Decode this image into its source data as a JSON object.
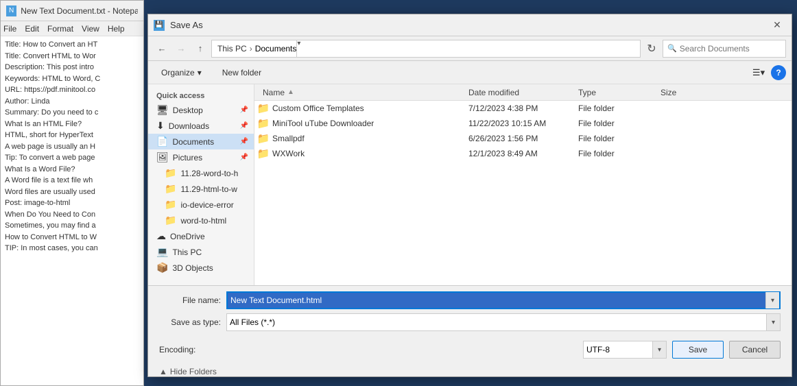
{
  "notepad": {
    "title": "New Text Document.txt - Notepad",
    "menu": [
      "File",
      "Edit",
      "Format",
      "View",
      "Help"
    ],
    "lines": [
      "Title: How to Convert an HT",
      "Title: Convert HTML to Wor",
      "Description: This post intro",
      "Keywords: HTML to Word, C",
      "URL: https://pdf.minitool.co",
      "Author: Linda",
      "Summary: Do you need to c",
      "What Is an HTML File?",
      "HTML, short for HyperText",
      "A web page is usually an H",
      "Tip: To convert a web page",
      "What Is a Word File?",
      "A Word file is a text file wh",
      "Word files are usually used",
      "Post: image-to-html",
      "When Do You Need to Con",
      "Sometimes, you may find a",
      "How to Convert HTML to W",
      "TIP: In most cases, you can"
    ]
  },
  "dialog": {
    "title": "Save As",
    "close_label": "✕",
    "address": {
      "back_tooltip": "Back",
      "forward_tooltip": "Forward",
      "up_tooltip": "Up",
      "path_parts": [
        "This PC",
        "Documents"
      ],
      "refresh_label": "⟳",
      "search_placeholder": "Search Documents"
    },
    "toolbar": {
      "organize_label": "Organize",
      "organize_arrow": "▾",
      "new_folder_label": "New folder",
      "view_icon": "☰",
      "view_arrow": "▾",
      "help_label": "?"
    },
    "columns": {
      "name": "Name",
      "sort_arrow": "▲",
      "date_modified": "Date modified",
      "type": "Type",
      "size": "Size"
    },
    "sidebar": {
      "quick_access_label": "Quick access",
      "items": [
        {
          "id": "desktop",
          "label": "Desktop",
          "icon": "🖥",
          "pinned": true
        },
        {
          "id": "downloads",
          "label": "Downloads",
          "icon": "⬇",
          "pinned": true
        },
        {
          "id": "documents",
          "label": "Documents",
          "icon": "📄",
          "pinned": true,
          "active": true
        },
        {
          "id": "pictures",
          "label": "Pictures",
          "icon": "🖼",
          "pinned": true
        },
        {
          "id": "folder1",
          "label": "11.28-word-to-h",
          "icon": "📁"
        },
        {
          "id": "folder2",
          "label": "11.29-html-to-w",
          "icon": "📁"
        },
        {
          "id": "folder3",
          "label": "io-device-error",
          "icon": "📁"
        },
        {
          "id": "folder4",
          "label": "word-to-html",
          "icon": "📁"
        },
        {
          "id": "onedrive",
          "label": "OneDrive",
          "icon": "☁"
        },
        {
          "id": "thispc",
          "label": "This PC",
          "icon": "💻"
        },
        {
          "id": "3dobjects",
          "label": "3D Objects",
          "icon": "📦"
        }
      ]
    },
    "files": [
      {
        "name": "Custom Office Templates",
        "date": "7/12/2023 4:38 PM",
        "type": "File folder",
        "size": ""
      },
      {
        "name": "MiniTool uTube Downloader",
        "date": "11/22/2023 10:15 AM",
        "type": "File folder",
        "size": ""
      },
      {
        "name": "Smallpdf",
        "date": "6/26/2023 1:56 PM",
        "type": "File folder",
        "size": ""
      },
      {
        "name": "WXWork",
        "date": "12/1/2023 8:49 AM",
        "type": "File folder",
        "size": ""
      }
    ],
    "bottom": {
      "filename_label": "File name:",
      "filename_value": "New Text Document.html",
      "savetype_label": "Save as type:",
      "savetype_value": "All Files (*.*)",
      "encoding_label": "Encoding:",
      "encoding_value": "UTF-8",
      "save_label": "Save",
      "cancel_label": "Cancel",
      "hide_folders_label": "Hide Folders",
      "hide_folders_arrow": "▲"
    }
  }
}
